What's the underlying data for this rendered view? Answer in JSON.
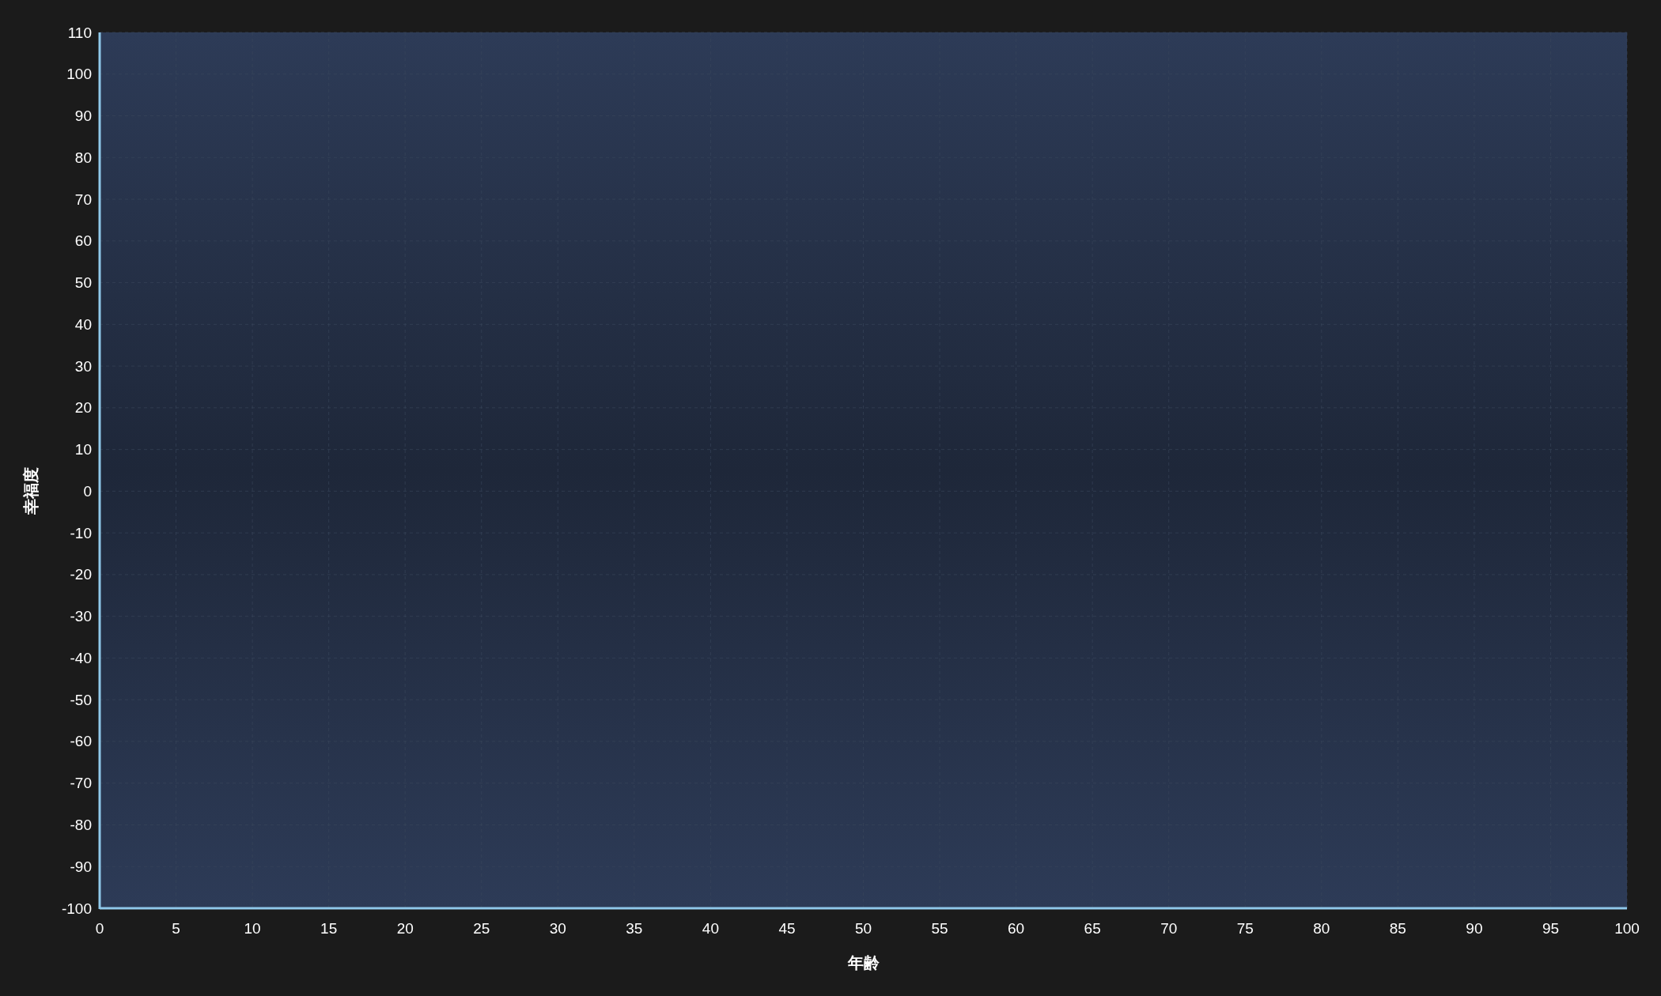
{
  "chart": {
    "chart_data": {
      "type": "line",
      "grid": true,
      "xlabel": "年齢",
      "ylabel": "幸福度",
      "xlim": [
        0,
        100
      ],
      "ylim": [
        -100,
        110
      ],
      "xticks": [
        0,
        5,
        10,
        15,
        20,
        25,
        30,
        35,
        40,
        45,
        50,
        55,
        60,
        65,
        70,
        75,
        80,
        85,
        90,
        95,
        100
      ],
      "yticks": [
        -100,
        -90,
        -80,
        -70,
        -60,
        -50,
        -40,
        -30,
        -20,
        -10,
        0,
        10,
        20,
        30,
        40,
        50,
        60,
        70,
        80,
        90,
        100,
        110
      ]
    }
  }
}
